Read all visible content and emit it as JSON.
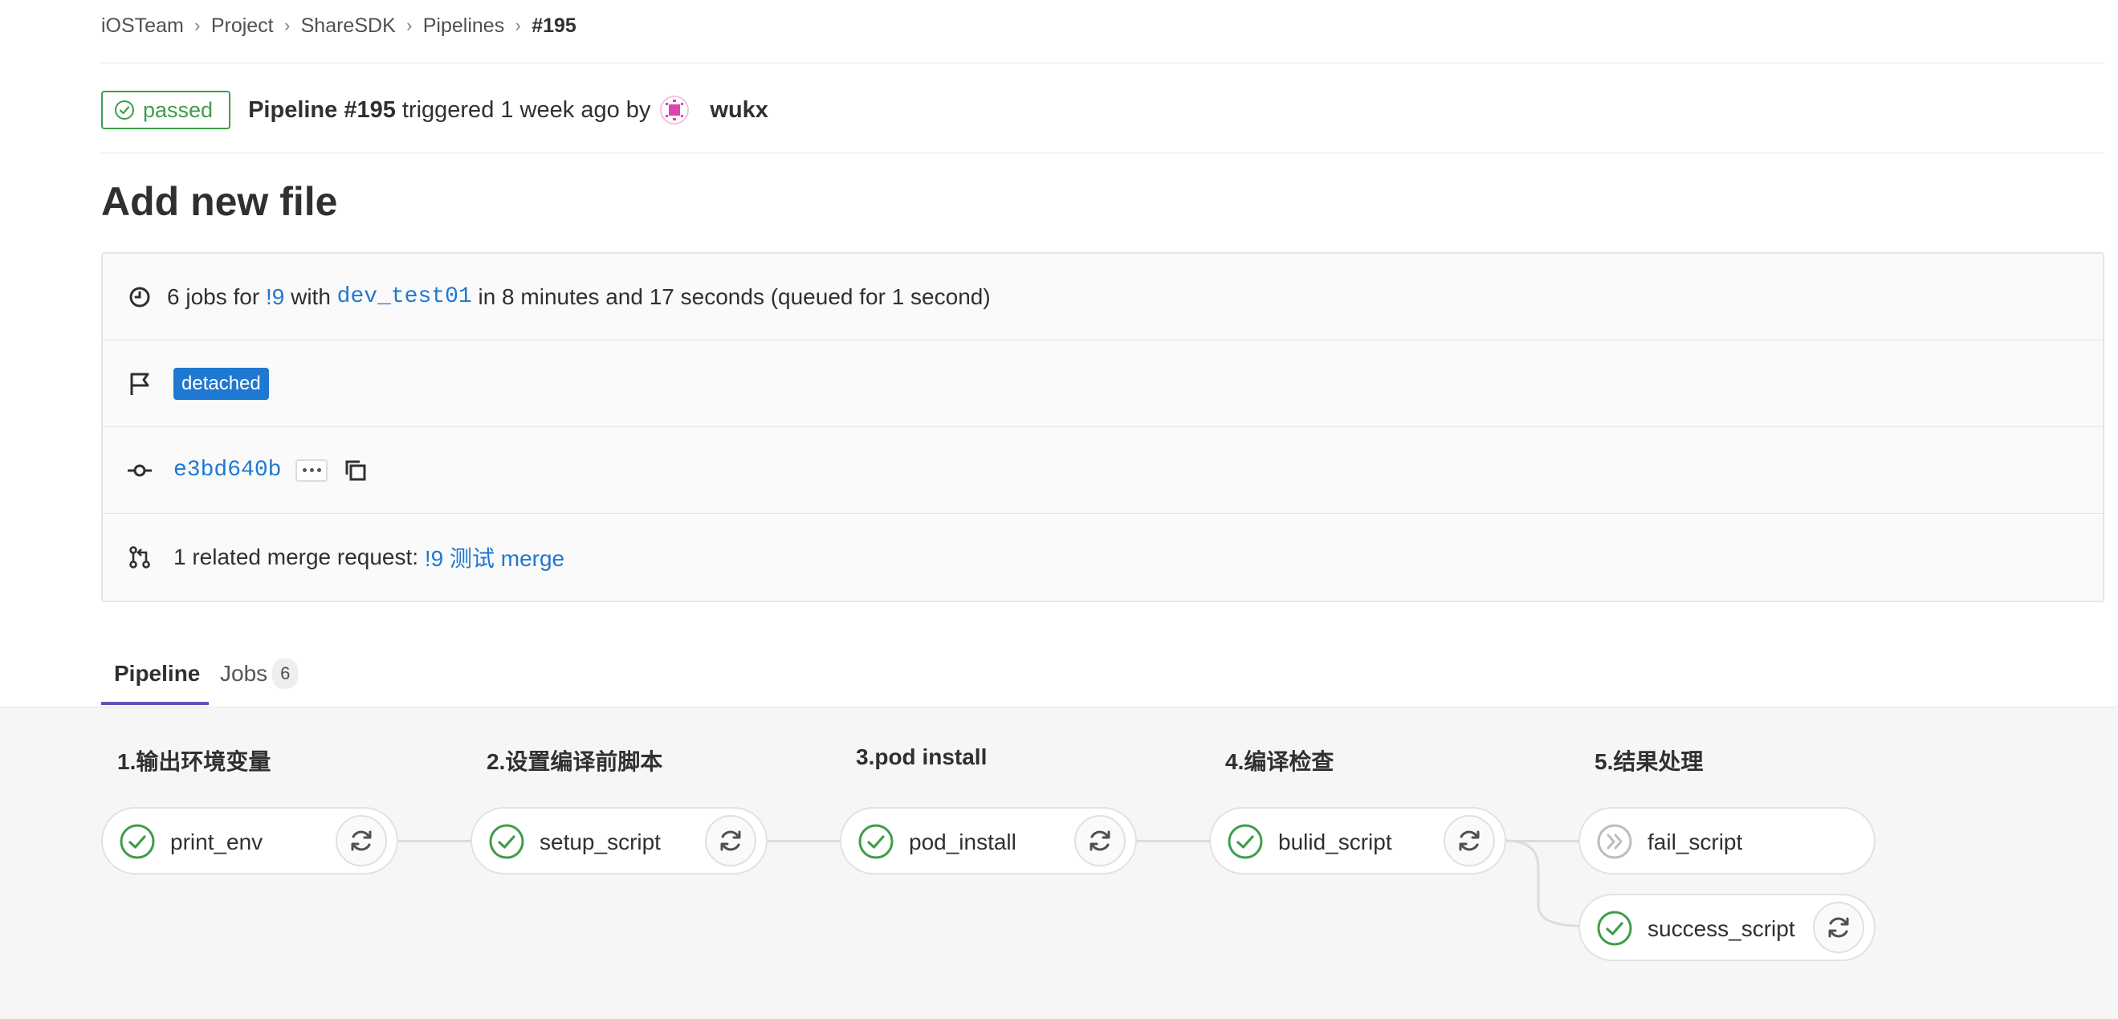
{
  "breadcrumb": [
    "iOSTeam",
    "Project",
    "ShareSDK",
    "Pipelines",
    "#195"
  ],
  "header": {
    "status": "passed",
    "pipeline_id": "Pipeline #195",
    "trigger_text": "triggered 1 week ago by",
    "author": "wukx"
  },
  "title": "Add new file",
  "info": {
    "jobs_prefix": "6 jobs for",
    "mr_ref": "!9",
    "with_text": "with",
    "branch": "dev_test01",
    "duration_text": "in 8 minutes and 17 seconds (queued for 1 second)",
    "tag": "detached",
    "commit_sha": "e3bd640b",
    "related_prefix": "1 related merge request:",
    "related_link": "!9 测试 merge"
  },
  "tabs": [
    {
      "label": "Pipeline",
      "active": true
    },
    {
      "label": "Jobs",
      "count": "6",
      "active": false
    }
  ],
  "stages": [
    {
      "title": "1.输出环境变量",
      "jobs": [
        {
          "name": "print_env",
          "status": "success",
          "retry": true
        }
      ]
    },
    {
      "title": "2.设置编译前脚本",
      "jobs": [
        {
          "name": "setup_script",
          "status": "success",
          "retry": true
        }
      ]
    },
    {
      "title": "3.pod install",
      "jobs": [
        {
          "name": "pod_install",
          "status": "success",
          "retry": true
        }
      ]
    },
    {
      "title": "4.编译检查",
      "jobs": [
        {
          "name": "bulid_script",
          "status": "success",
          "retry": true
        }
      ]
    },
    {
      "title": "5.结果处理",
      "jobs": [
        {
          "name": "fail_script",
          "status": "skipped",
          "retry": false
        },
        {
          "name": "success_script",
          "status": "success",
          "retry": true
        }
      ]
    }
  ],
  "colors": {
    "success": "#3e9d4a",
    "link": "#1f78d1",
    "tab_underline": "#6b4fbb",
    "avatar": "#e040b0"
  }
}
